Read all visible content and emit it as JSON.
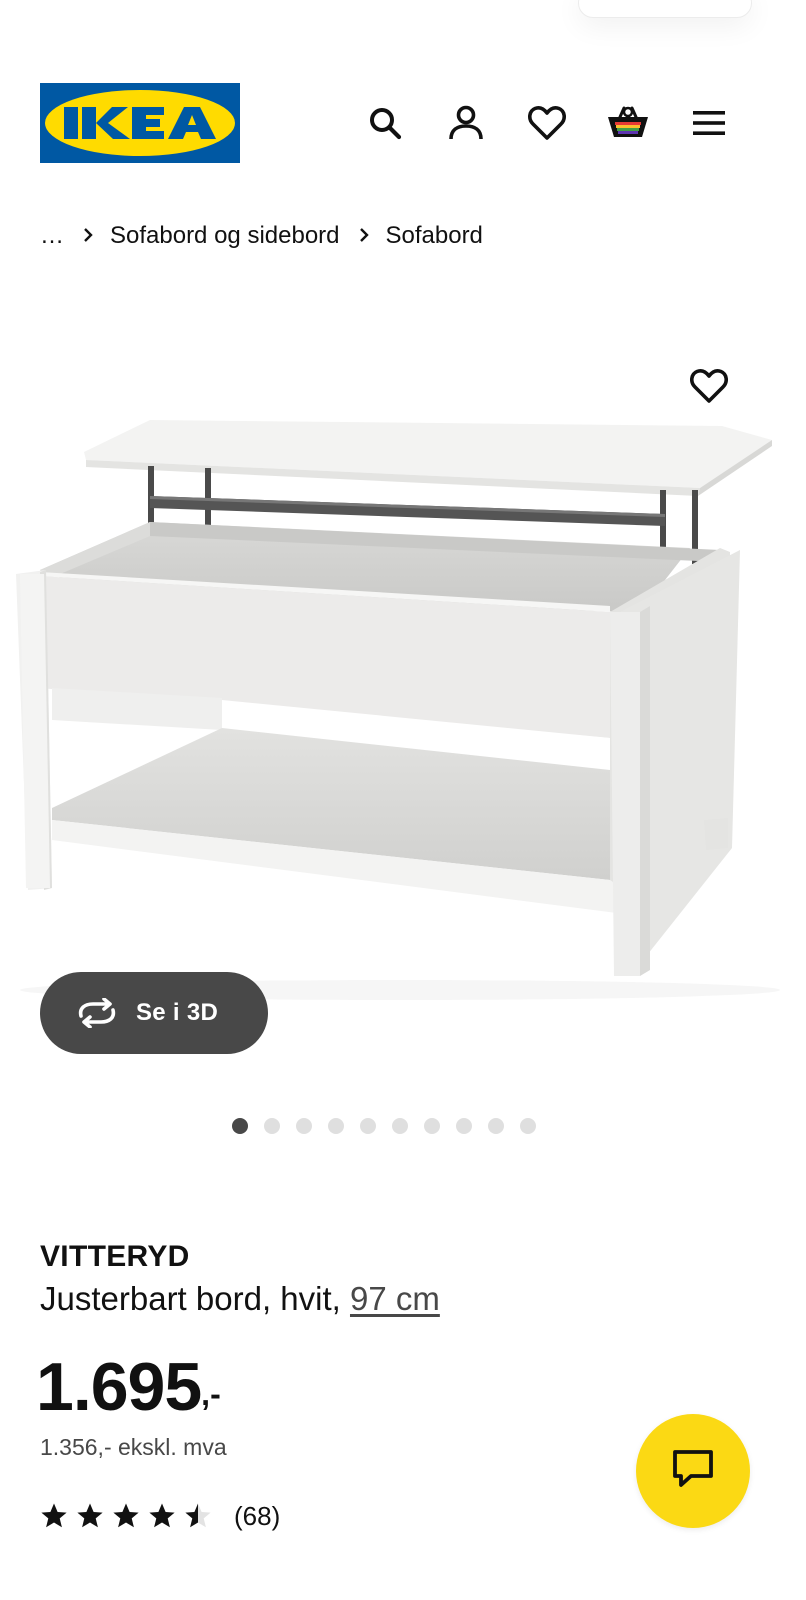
{
  "header": {
    "logo_text": "IKEA",
    "icons": [
      "search-icon",
      "account-icon",
      "heart-icon",
      "shopping-bag-icon",
      "hamburger-menu-icon"
    ]
  },
  "breadcrumb": {
    "ellipsis": "…",
    "items": [
      "Sofabord og sidebord",
      "Sofabord"
    ]
  },
  "gallery": {
    "view_3d_label": "Se i 3D",
    "image_count": 10,
    "active_index": 0
  },
  "product": {
    "name": "VITTERYD",
    "description": "Justerbart bord, hvit, ",
    "size_link": "97 cm",
    "price_integer": "1.695",
    "price_suffix": ",-",
    "price_excl_vat": "1.356,- ekskl. mva",
    "rating": 4.5,
    "rating_max": 5,
    "review_count": "(68)"
  },
  "colors": {
    "ikea_blue": "#0058a3",
    "ikea_yellow": "#ffdb00",
    "button_dark": "#484848",
    "chat_yellow": "#fbd914"
  }
}
